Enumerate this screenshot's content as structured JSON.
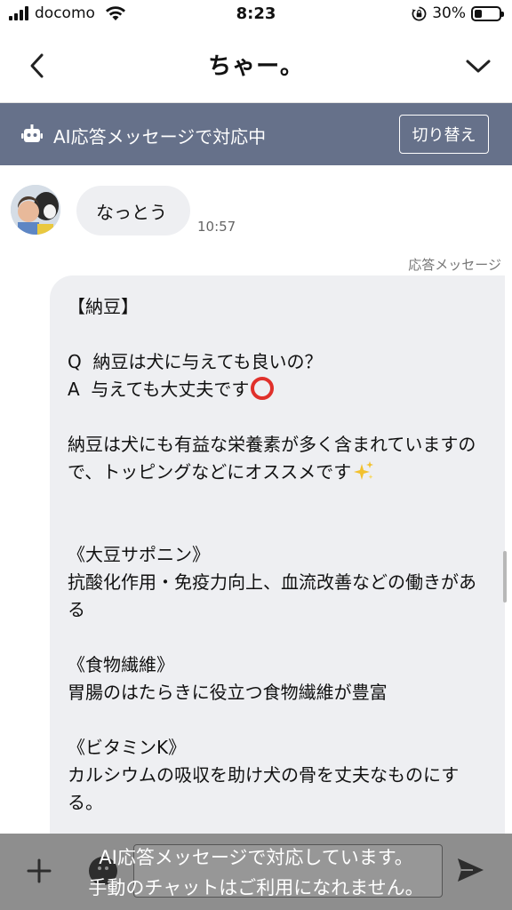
{
  "status_bar": {
    "carrier": "docomo",
    "time": "8:23",
    "battery_percent": "30%",
    "battery_level": 0.3
  },
  "header": {
    "title": "ちゃー。",
    "back_icon": "chevron-left-icon",
    "menu_icon": "chevron-down-icon"
  },
  "ai_banner": {
    "text": "AI応答メッセージで対応中",
    "switch_label": "切り替え",
    "background": "#66718a"
  },
  "messages": {
    "incoming": {
      "text": "なっとう",
      "time": "10:57"
    },
    "response_label": "応答メッセージ",
    "outgoing": {
      "title": "【納豆】",
      "q": "Q  納豆は犬に与えても良いの？",
      "a": "A  与えても大丈夫です",
      "a_icon": "red-circle-icon",
      "intro": "納豆は犬にも有益な栄養素が多く含まれていますので、トッピングなどにオススメです",
      "intro_icon": "sparkles-icon",
      "sections": [
        {
          "heading": "《大豆サポニン》",
          "body": "抗酸化作用・免疫力向上、血流改善などの働きがある"
        },
        {
          "heading": "《食物繊維》",
          "body": "胃腸のはたらきに役立つ食物繊維が豊富"
        },
        {
          "heading": "《ビタミンK》",
          "body": "カルシウムの吸収を助け犬の骨を丈夫なものにする。"
        }
      ]
    }
  },
  "input_bar": {
    "notice_line1": "AI応答メッセージで対応しています。",
    "notice_line2": "手動のチャットはご利用になれません。"
  }
}
